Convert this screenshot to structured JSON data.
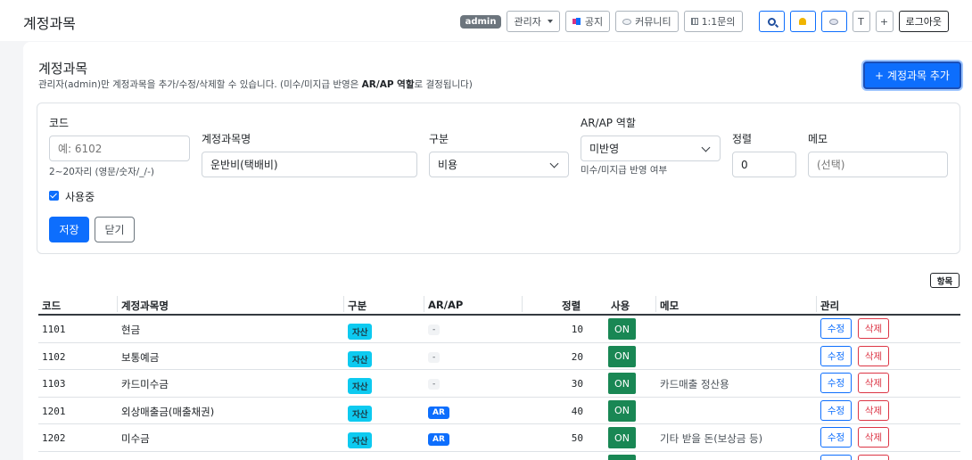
{
  "header": {
    "title": "계정과목",
    "badge": "admin",
    "role_dropdown": "관리자",
    "notice": "공지",
    "community": "커뮤니티",
    "inquiry": "1:1문의",
    "theme_btn": "T",
    "plus_btn": "+",
    "logout": "로그아웃"
  },
  "card": {
    "title": "계정과목",
    "desc_before": "관리자(admin)만 계정과목을 추가/수정/삭제할 수 있습니다. (미수/미지급 반영은 ",
    "desc_bold": "AR/AP 역할",
    "desc_after": "로 결정됩니다)",
    "add_button": "+ 계정과목 추가"
  },
  "form": {
    "code_label": "코드",
    "code_placeholder": "예: 6102",
    "code_help": "2~20자리 (영문/숫자/_/-)",
    "name_label": "계정과목명",
    "name_placeholder": "운반비(택배비)",
    "type_label": "구분",
    "type_value": "비용",
    "arap_label": "AR/AP 역할",
    "arap_value": "미반영",
    "arap_help": "미수/미지급 반영 여부",
    "sort_label": "정렬",
    "sort_value": "0",
    "memo_label": "메모",
    "memo_placeholder": "(선택)",
    "active_label": "사용중",
    "save": "저장",
    "close": "닫기"
  },
  "table": {
    "columns_button": "항목",
    "headers": {
      "code": "코드",
      "name": "계정과목명",
      "type": "구분",
      "arap": "AR/AP",
      "sort": "정렬",
      "use": "사용",
      "memo": "메모",
      "manage": "관리"
    },
    "rows": [
      {
        "code": "1101",
        "name": "현금",
        "type": "자산",
        "arap": "-",
        "sort": "10",
        "use": "ON",
        "memo": "",
        "edit": "수정",
        "delete": "삭제"
      },
      {
        "code": "1102",
        "name": "보통예금",
        "type": "자산",
        "arap": "-",
        "sort": "20",
        "use": "ON",
        "memo": "",
        "edit": "수정",
        "delete": "삭제"
      },
      {
        "code": "1103",
        "name": "카드미수금",
        "type": "자산",
        "arap": "-",
        "sort": "30",
        "use": "ON",
        "memo": "카드매출 정산용",
        "edit": "수정",
        "delete": "삭제"
      },
      {
        "code": "1201",
        "name": "외상매출금(매출채권)",
        "type": "자산",
        "arap": "AR",
        "sort": "40",
        "use": "ON",
        "memo": "",
        "edit": "수정",
        "delete": "삭제"
      },
      {
        "code": "1202",
        "name": "미수금",
        "type": "자산",
        "arap": "AR",
        "sort": "50",
        "use": "ON",
        "memo": "기타 받을 돈(보상금 등)",
        "edit": "수정",
        "delete": "삭제"
      }
    ]
  },
  "colors": {
    "primary": "#0d6efd",
    "success": "#198754",
    "danger": "#dc3545",
    "info": "#0dcaf0"
  }
}
